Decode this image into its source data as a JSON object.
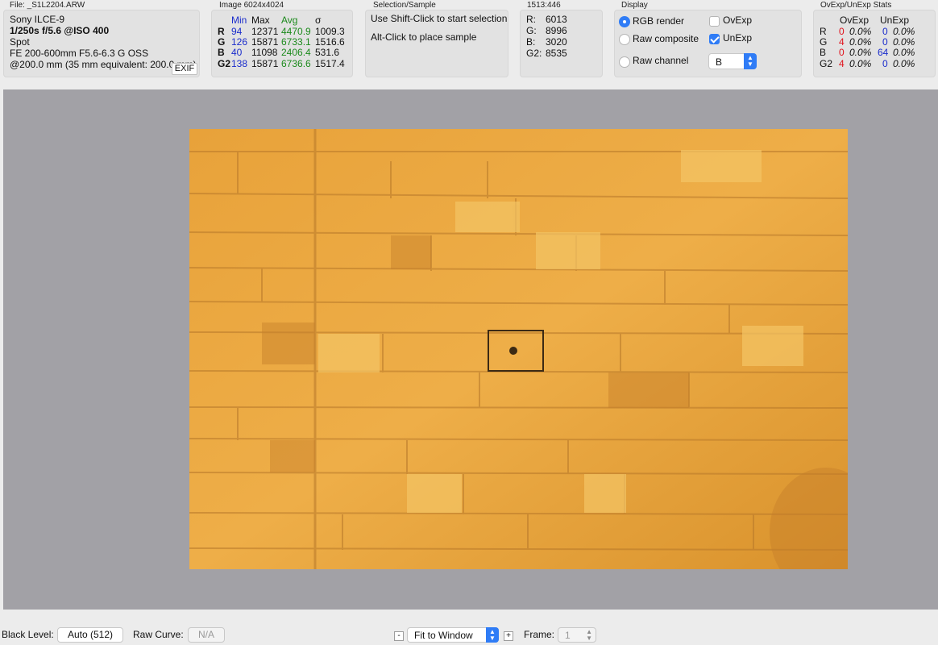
{
  "file": {
    "title": "File: _S1L2204.ARW",
    "camera": "Sony ILCE-9",
    "exposure": "1/250s f/5.6 @ISO 400",
    "metering": "Spot",
    "lens": "FE 200-600mm F5.6-6.3 G OSS",
    "focal": "@200.0 mm (35 mm equivalent: 200.0 mm)",
    "exif_label": "EXIF"
  },
  "image_stats": {
    "title": "Image 6024x4024",
    "headers": [
      "Min",
      "Max",
      "Avg",
      "σ"
    ],
    "rows": [
      {
        "ch": "R",
        "min": "94",
        "max": "12371",
        "avg": "4470.9",
        "sd": "1009.3"
      },
      {
        "ch": "G",
        "min": "126",
        "max": "15871",
        "avg": "6733.1",
        "sd": "1516.6"
      },
      {
        "ch": "B",
        "min": "40",
        "max": "11098",
        "avg": "2406.4",
        "sd": "531.6"
      },
      {
        "ch": "G2",
        "min": "138",
        "max": "15871",
        "avg": "6736.6",
        "sd": "1517.4"
      }
    ]
  },
  "selection": {
    "title": "Selection/Sample",
    "line1": "Use Shift-Click to start selection",
    "line2": "Alt-Click to place sample"
  },
  "sample": {
    "title": "1513:446",
    "rows": [
      {
        "ch": "R:",
        "val": "6013"
      },
      {
        "ch": "G:",
        "val": "8996"
      },
      {
        "ch": "B:",
        "val": "3020"
      },
      {
        "ch": "G2:",
        "val": "8535"
      }
    ]
  },
  "display": {
    "title": "Display",
    "rgb_render": "RGB render",
    "raw_composite": "Raw composite",
    "raw_channel": "Raw channel",
    "ovexp": "OvExp",
    "unexp": "UnExp",
    "channel_value": "B",
    "selected_mode": "rgb_render",
    "ovexp_checked": false,
    "unexp_checked": true
  },
  "ovexp_stats": {
    "title": "OvExp/UnExp Stats",
    "headers": [
      "OvExp",
      "UnExp"
    ],
    "rows": [
      {
        "ch": "R",
        "ov_n": "0",
        "ov_p": "0.0%",
        "un_n": "0",
        "un_p": "0.0%"
      },
      {
        "ch": "G",
        "ov_n": "4",
        "ov_p": "0.0%",
        "un_n": "0",
        "un_p": "0.0%"
      },
      {
        "ch": "B",
        "ov_n": "0",
        "ov_p": "0.0%",
        "un_n": "64",
        "un_p": "0.0%"
      },
      {
        "ch": "G2",
        "ov_n": "4",
        "ov_p": "0.0%",
        "un_n": "0",
        "un_p": "0.0%"
      }
    ]
  },
  "bottom": {
    "black_level_label": "Black Level:",
    "black_level_value": "Auto (512)",
    "raw_curve_label": "Raw Curve:",
    "raw_curve_value": "N/A",
    "zoom_minus": "-",
    "zoom_value": "Fit to Window",
    "zoom_plus": "+",
    "frame_label": "Frame:",
    "frame_value": "1"
  },
  "colors": {
    "accent": "#2f7cf6",
    "min_col": "#1a2ccc",
    "avg_col": "#1c8a1c",
    "ovexp_col": "#e0101a",
    "viewer_bg": "#a2a1a6"
  }
}
